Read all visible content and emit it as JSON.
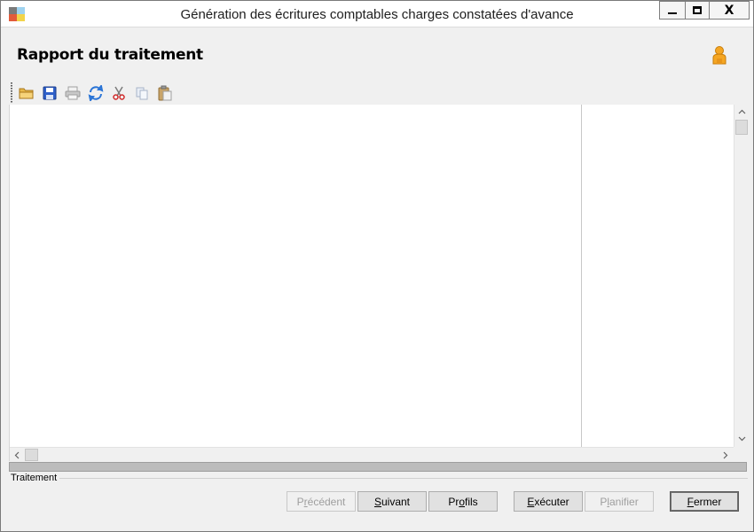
{
  "window": {
    "title": "Génération des écritures comptables charges constatées d'avance",
    "controls": {
      "minimize": "minimize-icon",
      "maximize": "maximize-icon",
      "close_glyph": "X"
    }
  },
  "header": {
    "title": "Rapport du traitement",
    "user_icon": "user-icon"
  },
  "toolbar": {
    "items": [
      {
        "name": "open-folder-icon",
        "enabled": true
      },
      {
        "name": "save-icon",
        "enabled": true
      },
      {
        "name": "print-icon",
        "enabled": false
      },
      {
        "name": "refresh-icon",
        "enabled": true
      },
      {
        "name": "cut-icon",
        "enabled": true
      },
      {
        "name": "copy-icon",
        "enabled": false
      },
      {
        "name": "paste-icon",
        "enabled": false
      }
    ]
  },
  "scrollbars": {
    "up_arrow": "^",
    "down_arrow": "v",
    "left_arrow": "<",
    "right_arrow": ">"
  },
  "progress": {
    "value": 0
  },
  "group": {
    "label": "Traitement"
  },
  "buttons": {
    "precedent": {
      "pre": "P",
      "key": "r",
      "post": "écédent",
      "enabled": false
    },
    "suivant": {
      "pre": "",
      "key": "S",
      "post": "uivant",
      "enabled": true
    },
    "profils": {
      "pre": "Pr",
      "key": "o",
      "post": "fils",
      "enabled": true
    },
    "executer": {
      "pre": "",
      "key": "E",
      "post": "xécuter",
      "enabled": true
    },
    "planifier": {
      "pre": "P",
      "key": "l",
      "post": "anifier",
      "enabled": false
    },
    "fermer": {
      "pre": "",
      "key": "F",
      "post": "ermer",
      "enabled": true
    }
  },
  "colors": {
    "window_bg": "#f0f0f0",
    "content_bg": "#ffffff",
    "progress_bg": "#bcbcbc",
    "progress_fill": "#06b025"
  }
}
